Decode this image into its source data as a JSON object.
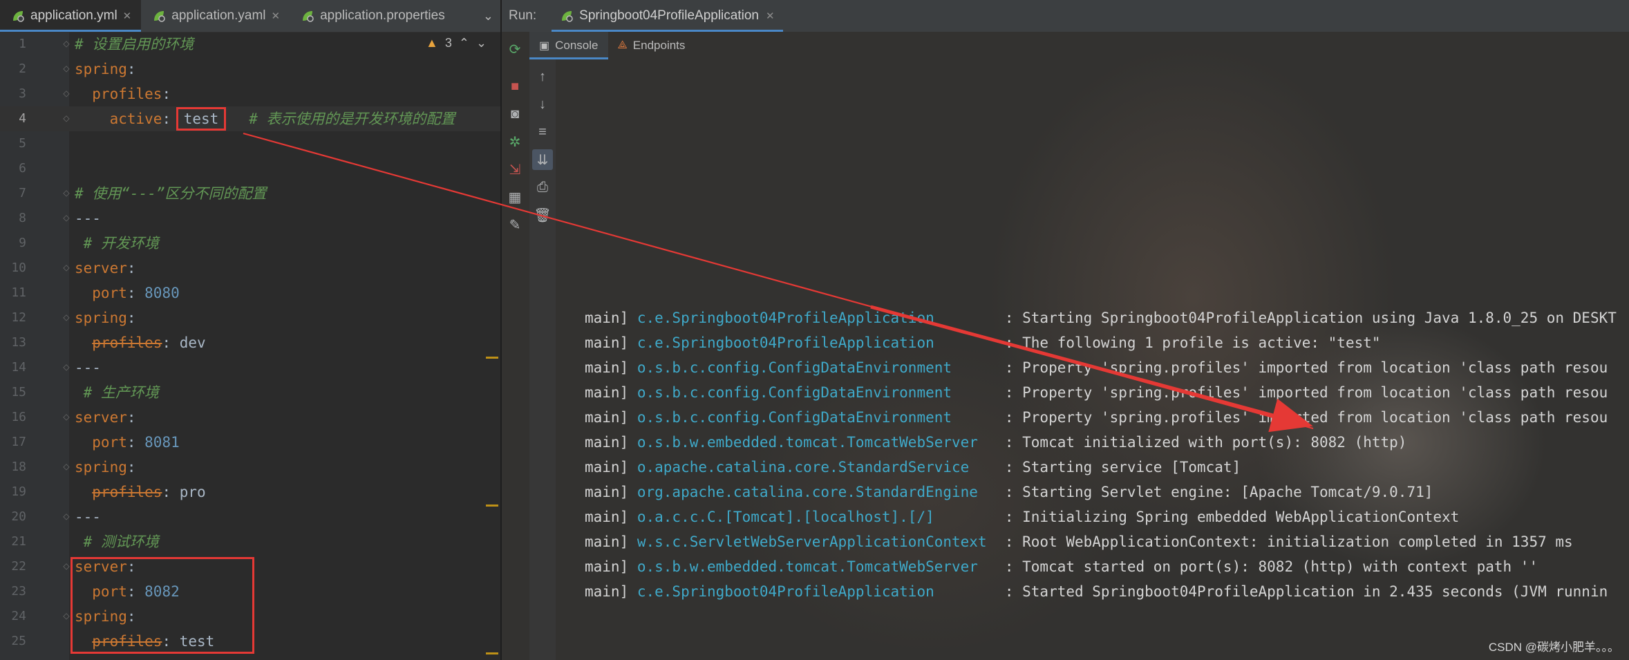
{
  "editor": {
    "tabs": [
      {
        "label": "application.yml",
        "active": true
      },
      {
        "label": "application.yaml",
        "active": false
      },
      {
        "label": "application.properties",
        "active": false
      }
    ],
    "warnings": {
      "count": "3",
      "icon": "warning-icon"
    },
    "lines": [
      {
        "n": "1",
        "html_parts": [
          {
            "t": "# 设置启用的环境",
            "c": "cm"
          }
        ]
      },
      {
        "n": "2",
        "html_parts": [
          {
            "t": "spring",
            "c": "k"
          },
          {
            "t": ":",
            "c": ""
          }
        ]
      },
      {
        "n": "3",
        "html_parts": [
          {
            "t": "  profiles",
            "c": "k"
          },
          {
            "t": ":",
            "c": ""
          }
        ]
      },
      {
        "n": "4",
        "html_parts": [
          {
            "t": "    active",
            "c": "k"
          },
          {
            "t": ": ",
            "c": ""
          },
          {
            "t": "test",
            "c": "box"
          },
          {
            "t": "   # 表示使用的是开发环境的配置",
            "c": "cm"
          }
        ]
      },
      {
        "n": "5",
        "html_parts": []
      },
      {
        "n": "6",
        "html_parts": []
      },
      {
        "n": "7",
        "html_parts": [
          {
            "t": "# 使用“---”区分不同的配置",
            "c": "cm"
          }
        ]
      },
      {
        "n": "8",
        "html_parts": [
          {
            "t": "---",
            "c": ""
          }
        ]
      },
      {
        "n": "9",
        "html_parts": [
          {
            "t": " # 开发环境",
            "c": "cm"
          }
        ]
      },
      {
        "n": "10",
        "html_parts": [
          {
            "t": "server",
            "c": "k"
          },
          {
            "t": ":",
            "c": ""
          }
        ]
      },
      {
        "n": "11",
        "html_parts": [
          {
            "t": "  port",
            "c": "k"
          },
          {
            "t": ": ",
            "c": ""
          },
          {
            "t": "8080",
            "c": "num"
          }
        ]
      },
      {
        "n": "12",
        "html_parts": [
          {
            "t": "spring",
            "c": "k"
          },
          {
            "t": ":",
            "c": ""
          }
        ]
      },
      {
        "n": "13",
        "html_parts": [
          {
            "t": "  ",
            "c": ""
          },
          {
            "t": "profiles",
            "c": "strike"
          },
          {
            "t": ": dev",
            "c": ""
          }
        ]
      },
      {
        "n": "14",
        "html_parts": [
          {
            "t": "---",
            "c": ""
          }
        ]
      },
      {
        "n": "15",
        "html_parts": [
          {
            "t": " # 生产环境",
            "c": "cm"
          }
        ]
      },
      {
        "n": "16",
        "html_parts": [
          {
            "t": "server",
            "c": "k"
          },
          {
            "t": ":",
            "c": ""
          }
        ]
      },
      {
        "n": "17",
        "html_parts": [
          {
            "t": "  port",
            "c": "k"
          },
          {
            "t": ": ",
            "c": ""
          },
          {
            "t": "8081",
            "c": "num"
          }
        ]
      },
      {
        "n": "18",
        "html_parts": [
          {
            "t": "spring",
            "c": "k"
          },
          {
            "t": ":",
            "c": ""
          }
        ]
      },
      {
        "n": "19",
        "html_parts": [
          {
            "t": "  ",
            "c": ""
          },
          {
            "t": "profiles",
            "c": "strike"
          },
          {
            "t": ": pro",
            "c": ""
          }
        ]
      },
      {
        "n": "20",
        "html_parts": [
          {
            "t": "---",
            "c": ""
          }
        ]
      },
      {
        "n": "21",
        "html_parts": [
          {
            "t": " # 测试环境",
            "c": "cm"
          }
        ]
      },
      {
        "n": "22",
        "html_parts": [
          {
            "t": "server",
            "c": "k"
          },
          {
            "t": ":",
            "c": ""
          }
        ]
      },
      {
        "n": "23",
        "html_parts": [
          {
            "t": "  port",
            "c": "k"
          },
          {
            "t": ": ",
            "c": ""
          },
          {
            "t": "8082",
            "c": "num"
          }
        ]
      },
      {
        "n": "24",
        "html_parts": [
          {
            "t": "spring",
            "c": "k"
          },
          {
            "t": ":",
            "c": ""
          }
        ]
      },
      {
        "n": "25",
        "html_parts": [
          {
            "t": "  ",
            "c": ""
          },
          {
            "t": "profiles",
            "c": "strike"
          },
          {
            "t": ": test",
            "c": ""
          }
        ]
      }
    ],
    "current_line": "4"
  },
  "run": {
    "label": "Run:",
    "tab": "Springboot04ProfileApplication",
    "subtabs": [
      {
        "label": "Console",
        "icon": "console-icon",
        "active": true
      },
      {
        "label": "Endpoints",
        "icon": "endpoints-icon",
        "active": false
      }
    ],
    "logs": [
      {
        "thread": "main]",
        "logger": "c.e.Springboot04ProfileApplication",
        "msg": ": Starting Springboot04ProfileApplication using Java 1.8.0_25 on DESKT"
      },
      {
        "thread": "main]",
        "logger": "c.e.Springboot04ProfileApplication",
        "msg": ": The following 1 profile is active: \"test\""
      },
      {
        "thread": "main]",
        "logger": "o.s.b.c.config.ConfigDataEnvironment",
        "msg": ": Property 'spring.profiles' imported from location 'class path resou"
      },
      {
        "thread": "main]",
        "logger": "o.s.b.c.config.ConfigDataEnvironment",
        "msg": ": Property 'spring.profiles' imported from location 'class path resou"
      },
      {
        "thread": "main]",
        "logger": "o.s.b.c.config.ConfigDataEnvironment",
        "msg": ": Property 'spring.profiles' imported from location 'class path resou"
      },
      {
        "thread": "main]",
        "logger": "o.s.b.w.embedded.tomcat.TomcatWebServer",
        "msg": ": Tomcat initialized with port(s): 8082 (http)"
      },
      {
        "thread": "main]",
        "logger": "o.apache.catalina.core.StandardService",
        "msg": ": Starting service [Tomcat]"
      },
      {
        "thread": "main]",
        "logger": "org.apache.catalina.core.StandardEngine",
        "msg": ": Starting Servlet engine: [Apache Tomcat/9.0.71]"
      },
      {
        "thread": "main]",
        "logger": "o.a.c.c.C.[Tomcat].[localhost].[/]",
        "msg": ": Initializing Spring embedded WebApplicationContext"
      },
      {
        "thread": "main]",
        "logger": "w.s.c.ServletWebServerApplicationContext",
        "msg": ": Root WebApplicationContext: initialization completed in 1357 ms"
      },
      {
        "thread": "main]",
        "logger": "o.s.b.w.embedded.tomcat.TomcatWebServer",
        "msg": ": Tomcat started on port(s): 8082 (http) with context path ''"
      },
      {
        "thread": "main]",
        "logger": "c.e.Springboot04ProfileApplication",
        "msg": ": Started Springboot04ProfileApplication in 2.435 seconds (JVM runnin"
      }
    ],
    "toolbar_left": [
      "rerun-icon",
      "stop-icon",
      "camera-icon",
      "debug-icon",
      "exit-icon",
      "layout-icon",
      "pin-icon"
    ],
    "toolbar_right": [
      "up-arrow-icon",
      "down-arrow-icon",
      "soft-wrap-icon",
      "scroll-to-end-icon",
      "print-icon",
      "trash-icon"
    ]
  },
  "watermark": "CSDN @碳烤小肥羊。。。",
  "colors": {
    "accent": "#4a88c7",
    "annotation_red": "#e53935",
    "logger_cyan": "#3fa9c9"
  }
}
